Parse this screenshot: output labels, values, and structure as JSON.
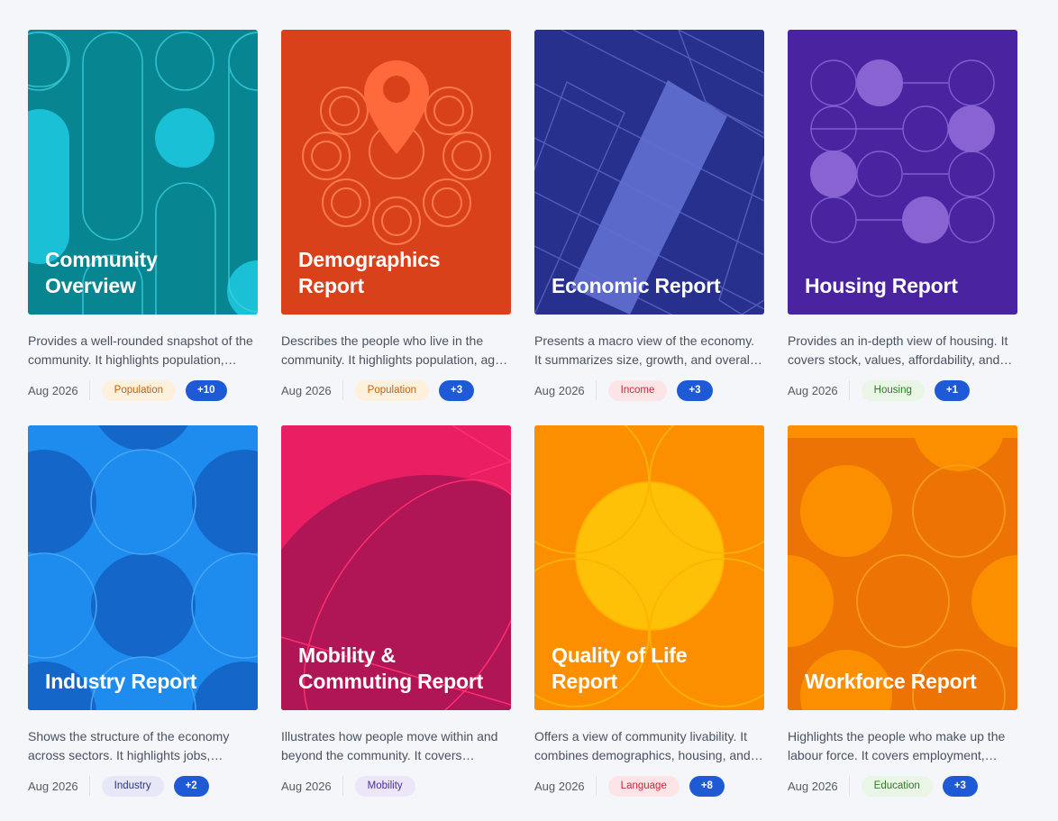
{
  "reports": [
    {
      "title": "Community\nOverview",
      "description": "Provides a well-rounded snapshot of the community. It highlights population, households, income, and more.",
      "date": "Aug 2026",
      "tag": "Population",
      "more": "+10",
      "cover_color": "#078590",
      "tag_bg": "#fdf1de",
      "tag_color": "#c4620a"
    },
    {
      "title": "Demographics\nReport",
      "description": "Describes the people who live in the community. It highlights population, age, and households.",
      "date": "Aug 2026",
      "tag": "Population",
      "more": "+3",
      "cover_color": "#d9411b",
      "tag_bg": "#fdf1de",
      "tag_color": "#c4620a"
    },
    {
      "title": "Economic Report",
      "description": "Presents a macro view of the economy. It summarizes size, growth, and overall performance.",
      "date": "Aug 2026",
      "tag": "Income",
      "more": "+3",
      "cover_color": "#27308c",
      "tag_bg": "#fde4e6",
      "tag_color": "#c8283a"
    },
    {
      "title": "Housing Report",
      "description": "Provides an in-depth view of housing. It covers stock, values, affordability, and more.",
      "date": "Aug 2026",
      "tag": "Housing",
      "more": "+1",
      "cover_color": "#4a24a0",
      "tag_bg": "#e9f6e6",
      "tag_color": "#2f7a26"
    },
    {
      "title": "Industry Report",
      "description": "Shows the structure of the economy across sectors. It highlights jobs, businesses, and more.",
      "date": "Aug 2026",
      "tag": "Industry",
      "more": "+2",
      "cover_color": "#1467c8",
      "tag_bg": "#e6e8f7",
      "tag_color": "#2a3584"
    },
    {
      "title": "Mobility &\nCommuting Report",
      "description": "Illustrates how people move within and beyond the community. It covers commuting and more.",
      "date": "Aug 2026",
      "tag": "Mobility",
      "more": "",
      "cover_color": "#b01556",
      "tag_bg": "#ece6f8",
      "tag_color": "#4b2c9a"
    },
    {
      "title": "Quality of Life\nReport",
      "description": "Offers a view of community livability. It combines demographics, housing, and more.",
      "date": "Aug 2026",
      "tag": "Language",
      "more": "+8",
      "cover_color": "#fb8f00",
      "tag_bg": "#fde4e6",
      "tag_color": "#c8283a"
    },
    {
      "title": "Workforce Report",
      "description": "Highlights the people who make up the labour force. It covers employment, education, and more.",
      "date": "Aug 2026",
      "tag": "Education",
      "more": "+3",
      "cover_color": "#ee7305",
      "tag_bg": "#e9f6e6",
      "tag_color": "#2f7a26"
    }
  ]
}
